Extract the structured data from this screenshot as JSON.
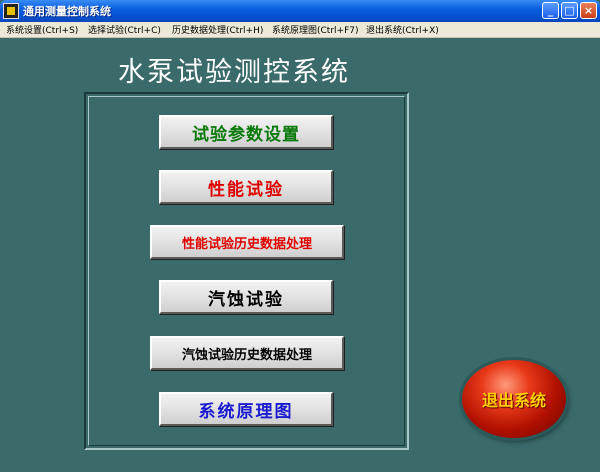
{
  "window": {
    "title": "通用测量控制系统",
    "minimize_glyph": "_",
    "maximize_glyph": "□",
    "close_glyph": "×"
  },
  "menu": [
    {
      "label": "系统设置(Ctrl+S)"
    },
    {
      "label": "选择试验(Ctrl+C)"
    },
    {
      "label": "历史数据处理(Ctrl+H)"
    },
    {
      "label": "系统原理图(Ctrl+F7)"
    },
    {
      "label": "退出系统(Ctrl+X)"
    }
  ],
  "main": {
    "title": "水泵试验测控系统",
    "buttons": [
      {
        "label": "试验参数设置",
        "color": "#0a7a0a"
      },
      {
        "label": "性能试验",
        "color": "#e00000"
      },
      {
        "label": "性能试验历史数据处理",
        "color": "#e00000"
      },
      {
        "label": "汽蚀试验",
        "color": "#000000"
      },
      {
        "label": "汽蚀试验历史数据处理",
        "color": "#000000"
      },
      {
        "label": "系统原理图",
        "color": "#1a1ad0"
      }
    ],
    "exit_label": "退出系统"
  },
  "colors": {
    "background": "#3a6a6a",
    "exit_text": "#ffd000"
  }
}
